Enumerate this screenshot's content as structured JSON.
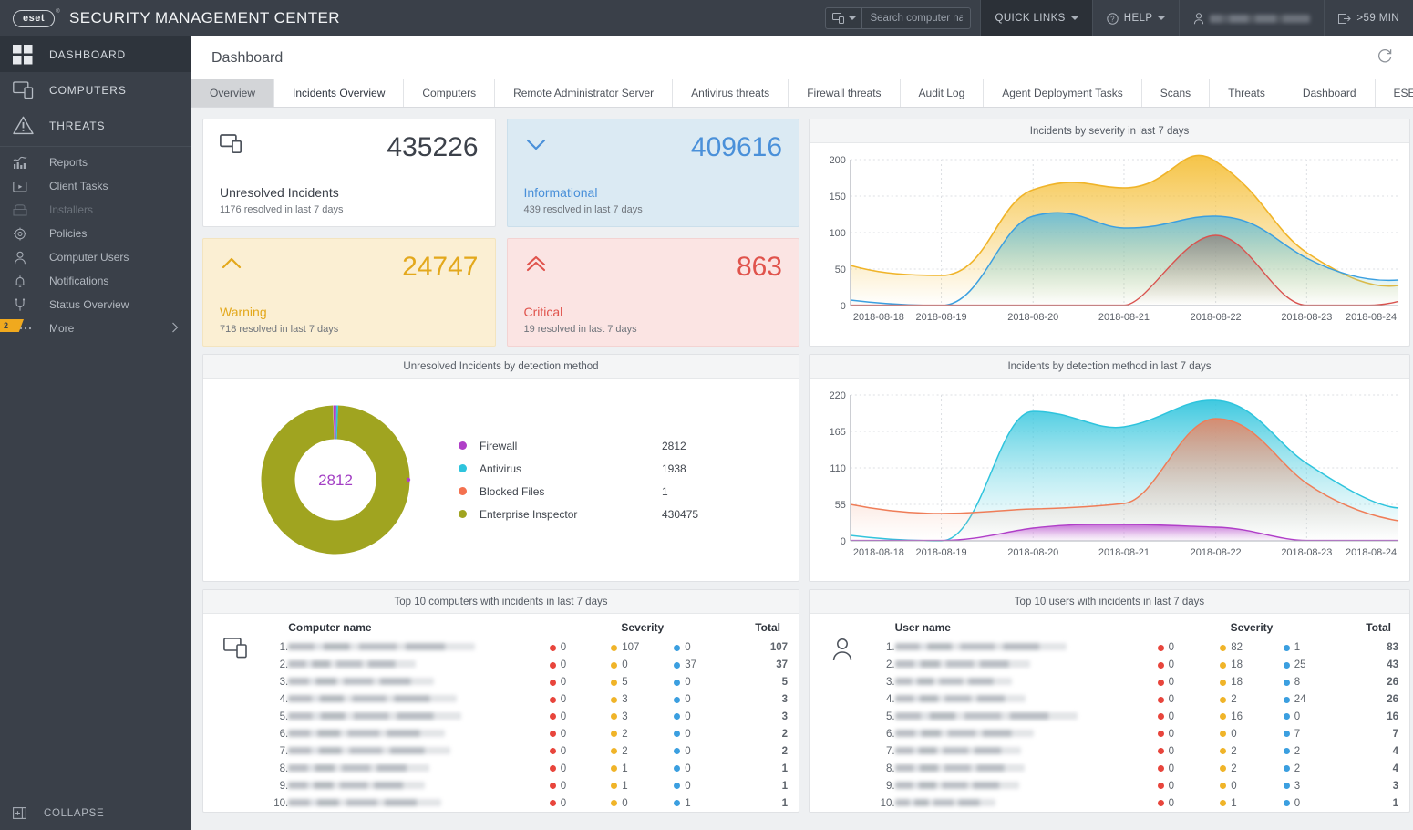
{
  "app": {
    "brand_logo": "eset",
    "brand_title": "SECURITY MANAGEMENT CENTER"
  },
  "topbar": {
    "search": {
      "placeholder": "Search computer na...",
      "value": "",
      "icon": "computer-icon"
    },
    "quick_links": "QUICK LINKS",
    "help": "HELP",
    "user": "",
    "session_timer": ">59 MIN"
  },
  "sidebar": {
    "main": [
      {
        "label": "DASHBOARD",
        "icon": "grid-icon",
        "selected": true
      },
      {
        "label": "COMPUTERS",
        "icon": "computer-icon",
        "selected": false
      },
      {
        "label": "THREATS",
        "icon": "warning-triangle-icon",
        "selected": false
      }
    ],
    "sub": [
      {
        "label": "Reports",
        "icon": "chart-icon",
        "dim": false,
        "badge": ""
      },
      {
        "label": "Client Tasks",
        "icon": "task-play-icon",
        "dim": false,
        "badge": ""
      },
      {
        "label": "Installers",
        "icon": "installer-box-icon",
        "dim": true,
        "badge": ""
      },
      {
        "label": "Policies",
        "icon": "gear-icon",
        "dim": false,
        "badge": ""
      },
      {
        "label": "Computer Users",
        "icon": "user-icon",
        "dim": false,
        "badge": ""
      },
      {
        "label": "Notifications",
        "icon": "bell-icon",
        "dim": false,
        "badge": ""
      },
      {
        "label": "Status Overview",
        "icon": "status-icon",
        "dim": false,
        "badge": ""
      },
      {
        "label": "More",
        "icon": "ellipsis-icon",
        "dim": false,
        "badge": "2"
      }
    ],
    "collapse": "COLLAPSE"
  },
  "page": {
    "title": "Dashboard",
    "refresh_icon": "refresh-icon"
  },
  "tabs": [
    {
      "label": "Overview",
      "state": "grayed"
    },
    {
      "label": "Incidents Overview",
      "state": "active"
    },
    {
      "label": "Computers",
      "state": "normal"
    },
    {
      "label": "Remote Administrator Server",
      "state": "normal"
    },
    {
      "label": "Antivirus threats",
      "state": "normal"
    },
    {
      "label": "Firewall threats",
      "state": "normal"
    },
    {
      "label": "Audit Log",
      "state": "normal"
    },
    {
      "label": "Agent Deployment Tasks",
      "state": "normal"
    },
    {
      "label": "Scans",
      "state": "normal"
    },
    {
      "label": "Threats",
      "state": "normal"
    },
    {
      "label": "Dashboard",
      "state": "normal"
    },
    {
      "label": "ESET applications",
      "state": "normal"
    }
  ],
  "tab_add": "+",
  "kpis": [
    {
      "value": "435226",
      "label": "Unresolved Incidents",
      "sub": "1176 resolved in last 7 days",
      "icon": "computer-icon",
      "color": "#3c414a"
    },
    {
      "value": "409616",
      "label": "Informational",
      "sub": "439 resolved in last 7 days",
      "icon": "chevron-down-icon",
      "color": "#4a90d9"
    },
    {
      "value": "24747",
      "label": "Warning",
      "sub": "718 resolved in last 7 days",
      "icon": "chevron-up-icon",
      "color": "#e3a81c"
    },
    {
      "value": "863",
      "label": "Critical",
      "sub": "19 resolved in last 7 days",
      "icon": "double-chevron-up-icon",
      "color": "#e0534c"
    }
  ],
  "donut_panel": {
    "title": "Unresolved Incidents by detection method",
    "center_value": "2812",
    "center_color": "#a33fc4"
  },
  "tables": {
    "computers": {
      "title": "Top 10 computers with incidents in last 7 days",
      "icon": "computer-icon",
      "headers": {
        "name": "Computer name",
        "severity": "Severity",
        "total": "Total"
      },
      "rows": [
        {
          "idx": "1.",
          "name": "",
          "crit": "0",
          "warn": "107",
          "info": "0",
          "total": "107"
        },
        {
          "idx": "2.",
          "name": "",
          "crit": "0",
          "warn": "0",
          "info": "37",
          "total": "37"
        },
        {
          "idx": "3.",
          "name": "",
          "crit": "0",
          "warn": "5",
          "info": "0",
          "total": "5"
        },
        {
          "idx": "4.",
          "name": "",
          "crit": "0",
          "warn": "3",
          "info": "0",
          "total": "3"
        },
        {
          "idx": "5.",
          "name": "",
          "crit": "0",
          "warn": "3",
          "info": "0",
          "total": "3"
        },
        {
          "idx": "6.",
          "name": "",
          "crit": "0",
          "warn": "2",
          "info": "0",
          "total": "2"
        },
        {
          "idx": "7.",
          "name": "",
          "crit": "0",
          "warn": "2",
          "info": "0",
          "total": "2"
        },
        {
          "idx": "8.",
          "name": "",
          "crit": "0",
          "warn": "1",
          "info": "0",
          "total": "1"
        },
        {
          "idx": "9.",
          "name": "",
          "crit": "0",
          "warn": "1",
          "info": "0",
          "total": "1"
        },
        {
          "idx": "10.",
          "name": "",
          "crit": "0",
          "warn": "0",
          "info": "1",
          "total": "1"
        }
      ]
    },
    "users": {
      "title": "Top 10 users with incidents in last 7 days",
      "icon": "user-icon",
      "headers": {
        "name": "User name",
        "severity": "Severity",
        "total": "Total"
      },
      "rows": [
        {
          "idx": "1.",
          "name": "",
          "crit": "0",
          "warn": "82",
          "info": "1",
          "total": "83"
        },
        {
          "idx": "2.",
          "name": "",
          "crit": "0",
          "warn": "18",
          "info": "25",
          "total": "43"
        },
        {
          "idx": "3.",
          "name": "",
          "crit": "0",
          "warn": "18",
          "info": "8",
          "total": "26"
        },
        {
          "idx": "4.",
          "name": "",
          "crit": "0",
          "warn": "2",
          "info": "24",
          "total": "26"
        },
        {
          "idx": "5.",
          "name": "",
          "crit": "0",
          "warn": "16",
          "info": "0",
          "total": "16"
        },
        {
          "idx": "6.",
          "name": "",
          "crit": "0",
          "warn": "0",
          "info": "7",
          "total": "7"
        },
        {
          "idx": "7.",
          "name": "",
          "crit": "0",
          "warn": "2",
          "info": "2",
          "total": "4"
        },
        {
          "idx": "8.",
          "name": "",
          "crit": "0",
          "warn": "2",
          "info": "2",
          "total": "4"
        },
        {
          "idx": "9.",
          "name": "",
          "crit": "0",
          "warn": "0",
          "info": "3",
          "total": "3"
        },
        {
          "idx": "10.",
          "name": "",
          "crit": "0",
          "warn": "1",
          "info": "0",
          "total": "1"
        }
      ]
    }
  },
  "colors": {
    "critical": "#e8453c",
    "warning": "#f0b429",
    "informational": "#3b9fe0",
    "firewall": "#b03fc8",
    "antivirus": "#2ec4dd",
    "blocked_files": "#f4714f",
    "enterprise_inspector": "#a0a420",
    "accent_dark": "#3a4049"
  },
  "chart_data": [
    {
      "type": "area",
      "id": "incidents-by-severity",
      "title": "Incidents by severity in last 7 days",
      "x": [
        "2018-08-18",
        "2018-08-19",
        "2018-08-20",
        "2018-08-21",
        "2018-08-22",
        "2018-08-23",
        "2018-08-24"
      ],
      "xlabel": "",
      "ylabel": "",
      "ylim": [
        0,
        200
      ],
      "yticks": [
        0,
        50,
        100,
        150,
        200
      ],
      "grid": true,
      "legend": "none",
      "stacked": false,
      "series": [
        {
          "name": "Warning",
          "color": "#f0b429",
          "values": [
            55,
            41,
            137,
            143,
            198,
            122,
            31
          ]
        },
        {
          "name": "Informational",
          "color": "#3b9fe0",
          "values": [
            7,
            0,
            122,
            107,
            123,
            90,
            36
          ]
        },
        {
          "name": "Critical",
          "color": "#d9534f",
          "values": [
            0,
            0,
            0,
            0,
            96,
            0,
            5
          ]
        }
      ]
    },
    {
      "type": "area",
      "id": "incidents-by-detection-method",
      "title": "Incidents by detection method in last 7 days",
      "x": [
        "2018-08-18",
        "2018-08-19",
        "2018-08-20",
        "2018-08-21",
        "2018-08-22",
        "2018-08-23",
        "2018-08-24"
      ],
      "xlabel": "",
      "ylabel": "",
      "ylim": [
        0,
        220
      ],
      "yticks": [
        0,
        55,
        110,
        165,
        220
      ],
      "grid": true,
      "legend": "none",
      "stacked": false,
      "series": [
        {
          "name": "Antivirus",
          "color": "#2ec4dd",
          "values": [
            7,
            0,
            195,
            172,
            210,
            118,
            45
          ]
        },
        {
          "name": "Blocked Files",
          "color": "#f4714f",
          "values": [
            55,
            40,
            48,
            57,
            188,
            85,
            24
          ]
        },
        {
          "name": "Firewall",
          "color": "#b03fc8",
          "values": [
            0,
            0,
            13,
            20,
            16,
            0,
            0
          ]
        }
      ]
    },
    {
      "type": "pie",
      "id": "unresolved-incidents-by-detection-method",
      "title": "Unresolved Incidents by detection method",
      "donut": true,
      "center_label": "2812",
      "labels": [
        "Firewall",
        "Antivirus",
        "Blocked Files",
        "Enterprise Inspector"
      ],
      "values": [
        2812,
        1938,
        1,
        430475
      ],
      "colors": [
        "#b03fc8",
        "#2ec4dd",
        "#f4714f",
        "#a0a420"
      ]
    }
  ]
}
